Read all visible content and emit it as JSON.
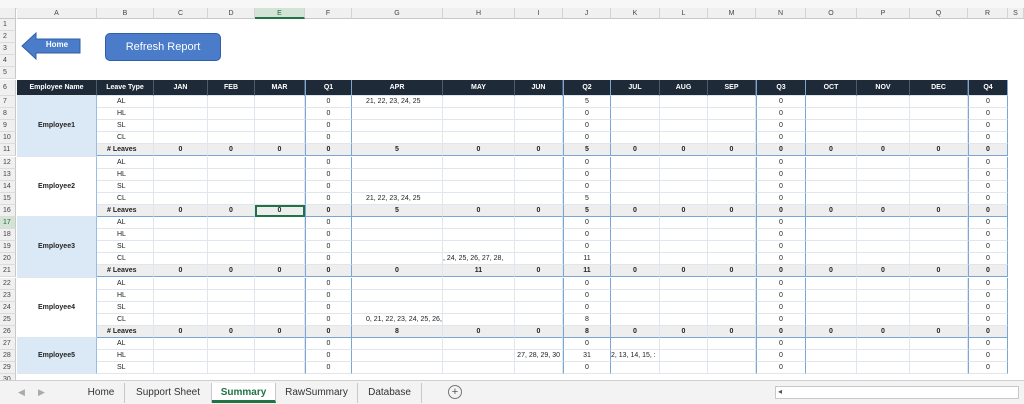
{
  "columns": [
    "A",
    "B",
    "C",
    "D",
    "E",
    "F",
    "G",
    "H",
    "I",
    "J",
    "K",
    "L",
    "M",
    "N",
    "O",
    "P",
    "Q",
    "R",
    "S"
  ],
  "selected_column": "E",
  "header_row": {
    "employee_name": "Employee Name",
    "leave_type": "Leave Type",
    "months": [
      "JAN",
      "FEB",
      "MAR",
      "Q1",
      "APR",
      "MAY",
      "JUN",
      "Q2",
      "JUL",
      "AUG",
      "SEP",
      "Q3",
      "OCT",
      "NOV",
      "DEC",
      "Q4"
    ]
  },
  "buttons": {
    "home": "Home",
    "refresh": "Refresh Report"
  },
  "leave_types": [
    "AL",
    "HL",
    "SL",
    "CL"
  ],
  "total_label": "# Leaves",
  "employees": [
    {
      "name": "Employee1",
      "rows": [
        {
          "APR": "21, 22, 23, 24, 25",
          "Q1": "0",
          "Q2": "5",
          "Q3": "0",
          "Q4": "0"
        },
        {
          "Q1": "0",
          "Q2": "0",
          "Q3": "0",
          "Q4": "0"
        },
        {
          "Q1": "0",
          "Q2": "0",
          "Q3": "0",
          "Q4": "0"
        },
        {
          "Q1": "0",
          "Q2": "0",
          "Q3": "0",
          "Q4": "0"
        }
      ],
      "total": [
        "0",
        "0",
        "0",
        "0",
        "5",
        "0",
        "0",
        "5",
        "0",
        "0",
        "0",
        "0",
        "0",
        "0",
        "0",
        "0"
      ]
    },
    {
      "name": "Employee2",
      "rows": [
        {
          "Q1": "0",
          "Q2": "0",
          "Q3": "0",
          "Q4": "0"
        },
        {
          "Q1": "0",
          "Q2": "0",
          "Q3": "0",
          "Q4": "0"
        },
        {
          "Q1": "0",
          "Q2": "0",
          "Q3": "0",
          "Q4": "0"
        },
        {
          "APR": "21, 22, 23, 24, 25",
          "Q1": "0",
          "Q2": "5",
          "Q3": "0",
          "Q4": "0"
        }
      ],
      "total": [
        "0",
        "0",
        "0",
        "0",
        "5",
        "0",
        "0",
        "5",
        "0",
        "0",
        "0",
        "0",
        "0",
        "0",
        "0",
        "0"
      ]
    },
    {
      "name": "Employee3",
      "rows": [
        {
          "Q1": "0",
          "Q2": "0",
          "Q3": "0",
          "Q4": "0"
        },
        {
          "Q1": "0",
          "Q2": "0",
          "Q3": "0",
          "Q4": "0"
        },
        {
          "Q1": "0",
          "Q2": "0",
          "Q3": "0",
          "Q4": "0"
        },
        {
          "MAY": ", 24, 25, 26, 27, 28,",
          "Q1": "0",
          "Q2": "11",
          "Q3": "0",
          "Q4": "0"
        }
      ],
      "total": [
        "0",
        "0",
        "0",
        "0",
        "0",
        "11",
        "0",
        "11",
        "0",
        "0",
        "0",
        "0",
        "0",
        "0",
        "0",
        "0"
      ]
    },
    {
      "name": "Employee4",
      "rows": [
        {
          "Q1": "0",
          "Q2": "0",
          "Q3": "0",
          "Q4": "0"
        },
        {
          "Q1": "0",
          "Q2": "0",
          "Q3": "0",
          "Q4": "0"
        },
        {
          "Q1": "0",
          "Q2": "0",
          "Q3": "0",
          "Q4": "0"
        },
        {
          "APR": "0, 21, 22, 23, 24, 25, 26, 2",
          "Q1": "0",
          "Q2": "8",
          "Q3": "0",
          "Q4": "0"
        }
      ],
      "total": [
        "0",
        "0",
        "0",
        "0",
        "8",
        "0",
        "0",
        "8",
        "0",
        "0",
        "0",
        "0",
        "0",
        "0",
        "0",
        "0"
      ]
    },
    {
      "name": "Employee5",
      "rows": [
        {
          "Q1": "0",
          "Q2": "0",
          "Q3": "0",
          "Q4": "0"
        },
        {
          "JUN": "27, 28, 29, 30",
          "JUL": "2, 13, 14, 15, :",
          "Q1": "0",
          "Q2": "31",
          "Q3": "0",
          "Q4": "0"
        },
        {
          "Q1": "0",
          "Q2": "0",
          "Q3": "0",
          "Q4": "0"
        }
      ]
    }
  ],
  "tabs": [
    "Home",
    "Support Sheet",
    "Summary",
    "RawSummary",
    "Database"
  ],
  "active_tab": "Summary",
  "add_sheet_icon": "plus-circle-icon"
}
